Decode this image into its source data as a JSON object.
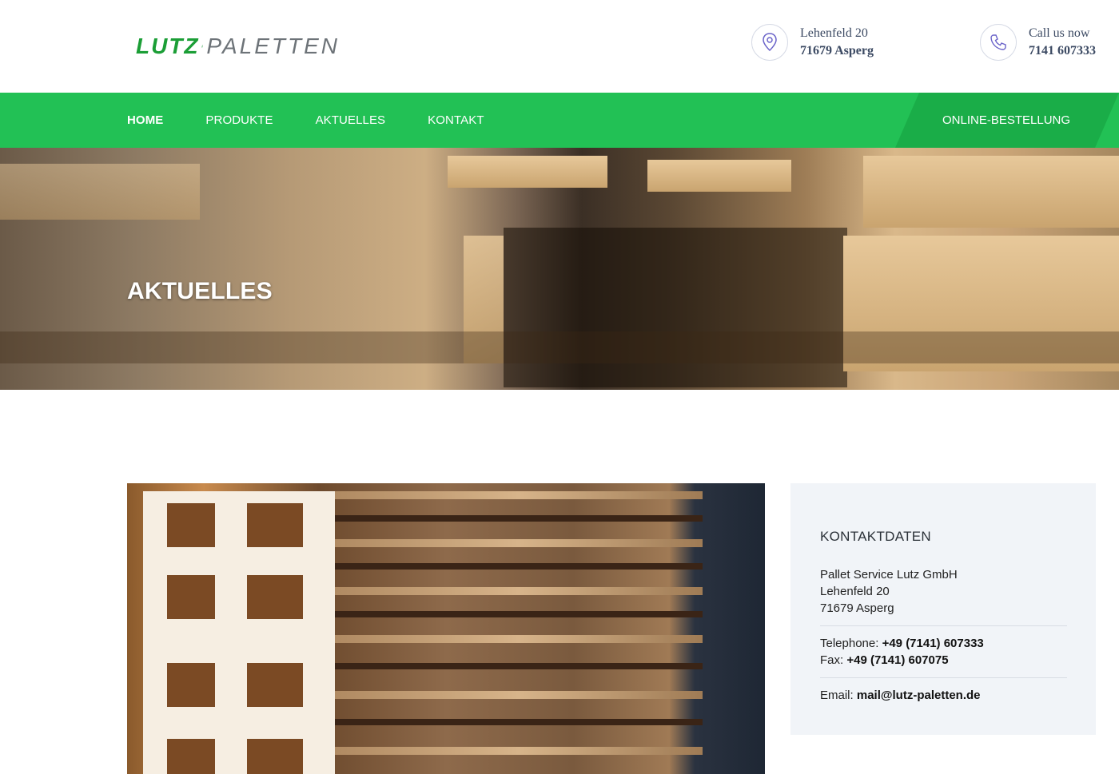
{
  "header": {
    "logo": {
      "word_left": "LUTZ",
      "word_right": "PALETTEN",
      "color_left": "#1b9e36",
      "color_right": "#6d7378"
    },
    "address": {
      "icon": "location-pin-icon",
      "line1": "Lehenfeld 20",
      "line2": "71679 Asperg"
    },
    "phone": {
      "icon": "phone-icon",
      "line1": "Call us now",
      "line2": "7141 607333"
    }
  },
  "nav": {
    "items": [
      {
        "label": "HOME",
        "active": true
      },
      {
        "label": "PRODUKTE",
        "active": false
      },
      {
        "label": "AKTUELLES",
        "active": false
      },
      {
        "label": "KONTAKT",
        "active": false
      }
    ],
    "order_button": "ONLINE-BESTELLUNG",
    "color_bar": "#22c155",
    "color_button": "#1aad48"
  },
  "hero": {
    "title": "AKTUELLES"
  },
  "sidebar": {
    "title": "KONTAKTDATEN",
    "company": "Pallet Service Lutz GmbH",
    "street": "Lehenfeld 20",
    "city": "71679 Asperg",
    "telephone_label": "Telephone:",
    "telephone_value": "+49 (7141) 607333",
    "fax_label": "Fax:",
    "fax_value": "+49 (7141) 607075",
    "email_label": "Email:",
    "email_value": "mail@lutz-paletten.de"
  }
}
